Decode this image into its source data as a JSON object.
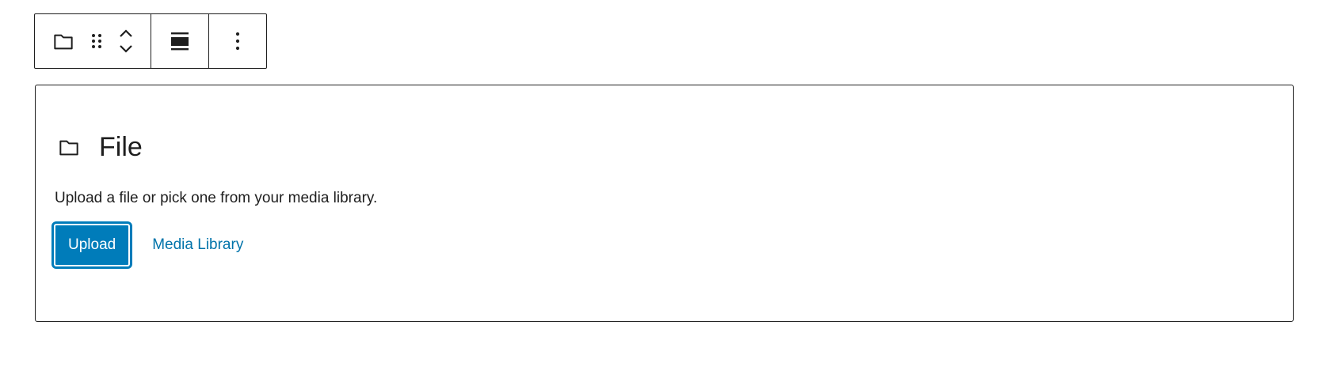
{
  "toolbar": {
    "block_type_icon": "folder-icon",
    "drag_icon": "drag-handle-icon",
    "move_up_icon": "chevron-up-icon",
    "move_down_icon": "chevron-down-icon",
    "align_icon": "align-wide-icon",
    "more_icon": "more-vertical-icon"
  },
  "placeholder": {
    "icon": "folder-icon",
    "title": "File",
    "instructions": "Upload a file or pick one from your media library.",
    "upload_label": "Upload",
    "media_library_label": "Media Library"
  },
  "colors": {
    "accent": "#007cba",
    "link": "#0073aa",
    "border": "#1e1e1e"
  }
}
